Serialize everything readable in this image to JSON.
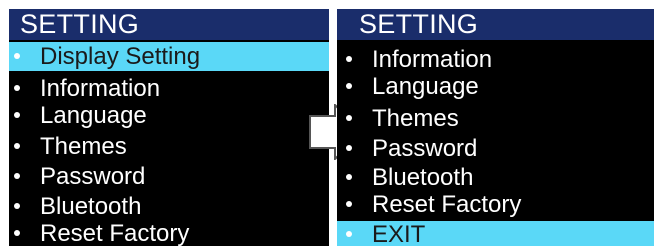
{
  "left_screen": {
    "title": "SETTING",
    "items": [
      {
        "label": "Display Setting"
      },
      {
        "label": "Information"
      },
      {
        "label": "Language"
      },
      {
        "label": "Themes"
      },
      {
        "label": "Password"
      },
      {
        "label": "Bluetooth"
      },
      {
        "label": "Reset Factory"
      }
    ]
  },
  "right_screen": {
    "title": "SETTING",
    "items": [
      {
        "label": "Information"
      },
      {
        "label": "Language"
      },
      {
        "label": "Themes"
      },
      {
        "label": "Password"
      },
      {
        "label": "Bluetooth"
      },
      {
        "label": "Reset Factory"
      },
      {
        "label": "EXIT"
      }
    ]
  },
  "colors": {
    "title_bar": "#1a2d6b",
    "screen_background": "#000000",
    "selection_highlight": "#5ad8f7",
    "text": "#ffffff"
  },
  "icons": {
    "transition": "right-arrow-icon",
    "bullet": "bullet-icon"
  }
}
